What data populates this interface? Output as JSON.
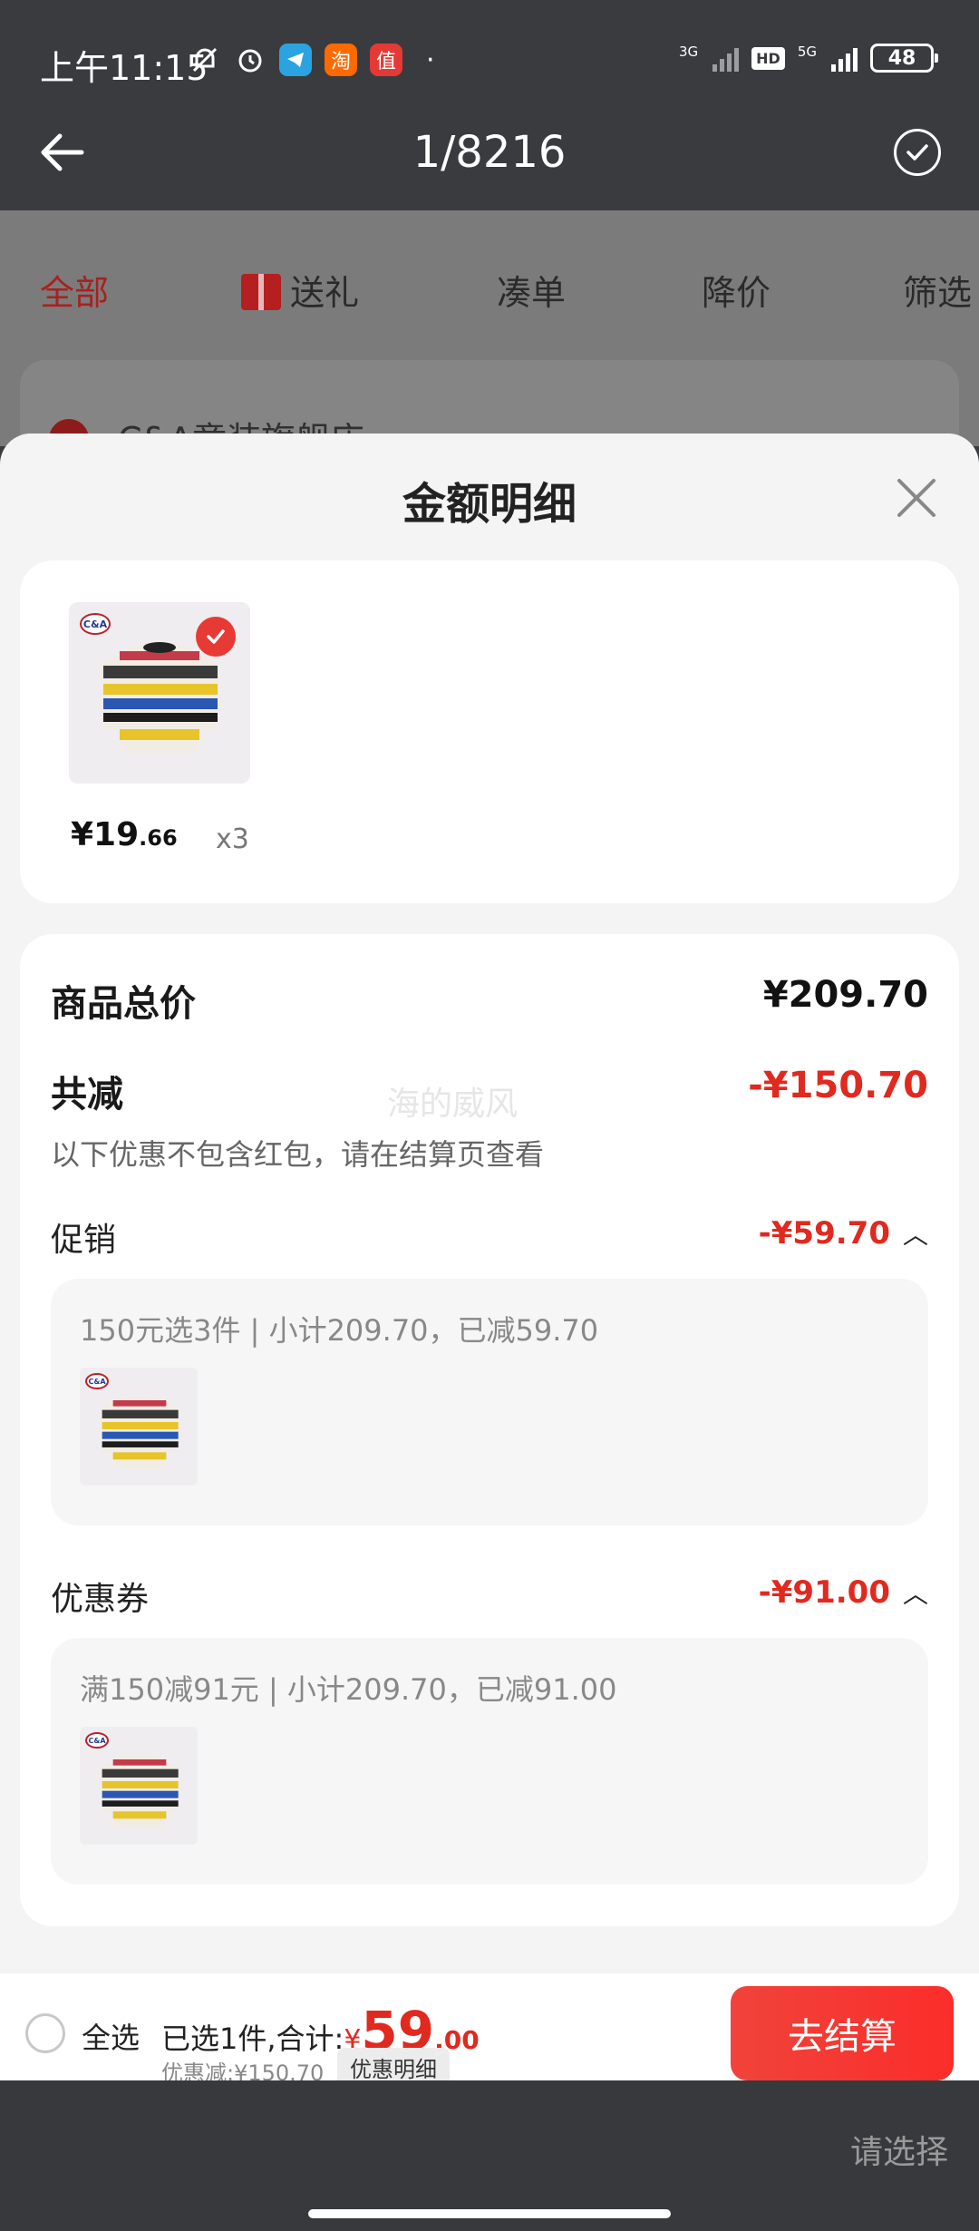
{
  "status_bar": {
    "time": "上午11:15",
    "icons": [
      "mute-icon",
      "alarm-icon",
      "telegram-icon",
      "taobao-icon",
      "zhi-icon"
    ],
    "network_left": "3G",
    "hd_badge": "HD",
    "network_right": "5G",
    "battery": "48"
  },
  "header": {
    "title": "1/8216"
  },
  "background_page": {
    "tabs": [
      "全部",
      "送礼",
      "凑单",
      "降价",
      "筛选"
    ],
    "shop_name": "C&A童装旗舰店 ›"
  },
  "sheet": {
    "title": "金额明细",
    "product": {
      "price_main": "¥19",
      "price_decimal": ".66",
      "quantity": "x3"
    },
    "summary": {
      "total_label": "商品总价",
      "total_value": "¥209.70",
      "reduce_label": "共减",
      "reduce_value": "-¥150.70",
      "note": "以下优惠不包含红包，请在结算页查看",
      "watermark": "海的威风"
    },
    "promotion": {
      "label": "促销",
      "value": "-¥59.70",
      "detail": "150元选3件 | 小计209.70，已减59.70"
    },
    "coupon": {
      "label": "优惠券",
      "value": "-¥91.00",
      "detail": "满150减91元 | 小计209.70，已减91.00"
    }
  },
  "checkout": {
    "select_all": "全选",
    "selected_text": "已选1件,合计:",
    "yen": "¥",
    "amount_main": "59",
    "amount_decimal": ".00",
    "discount": "优惠减:¥150.70",
    "detail_button": "优惠明细",
    "checkout_button": "去结算"
  },
  "system": {
    "hint": "请选择"
  },
  "colors": {
    "accent_red": "#e0291f",
    "button_red": "#f0433b",
    "header_bg": "#3a3b3f"
  }
}
